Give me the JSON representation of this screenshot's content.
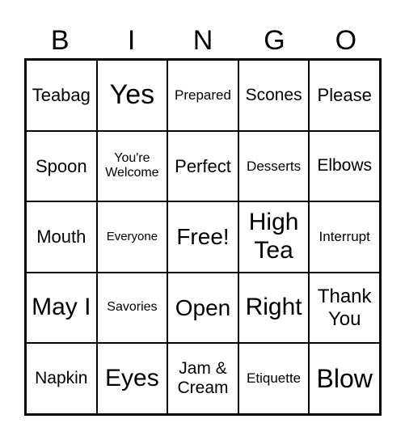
{
  "header": [
    "B",
    "I",
    "N",
    "G",
    "O"
  ],
  "cells": [
    [
      "Teabag",
      "Yes",
      "Prepared",
      "Scones",
      "Please"
    ],
    [
      "Spoon",
      "You're Welcome",
      "Perfect",
      "Desserts",
      "Elbows"
    ],
    [
      "Mouth",
      "Everyone",
      "Free!",
      "High Tea",
      "Interrupt"
    ],
    [
      "May I",
      "Savories",
      "Open",
      "Right",
      "Thank You"
    ],
    [
      "Napkin",
      "Eyes",
      "Jam & Cream",
      "Etiquette",
      "Blow"
    ]
  ]
}
